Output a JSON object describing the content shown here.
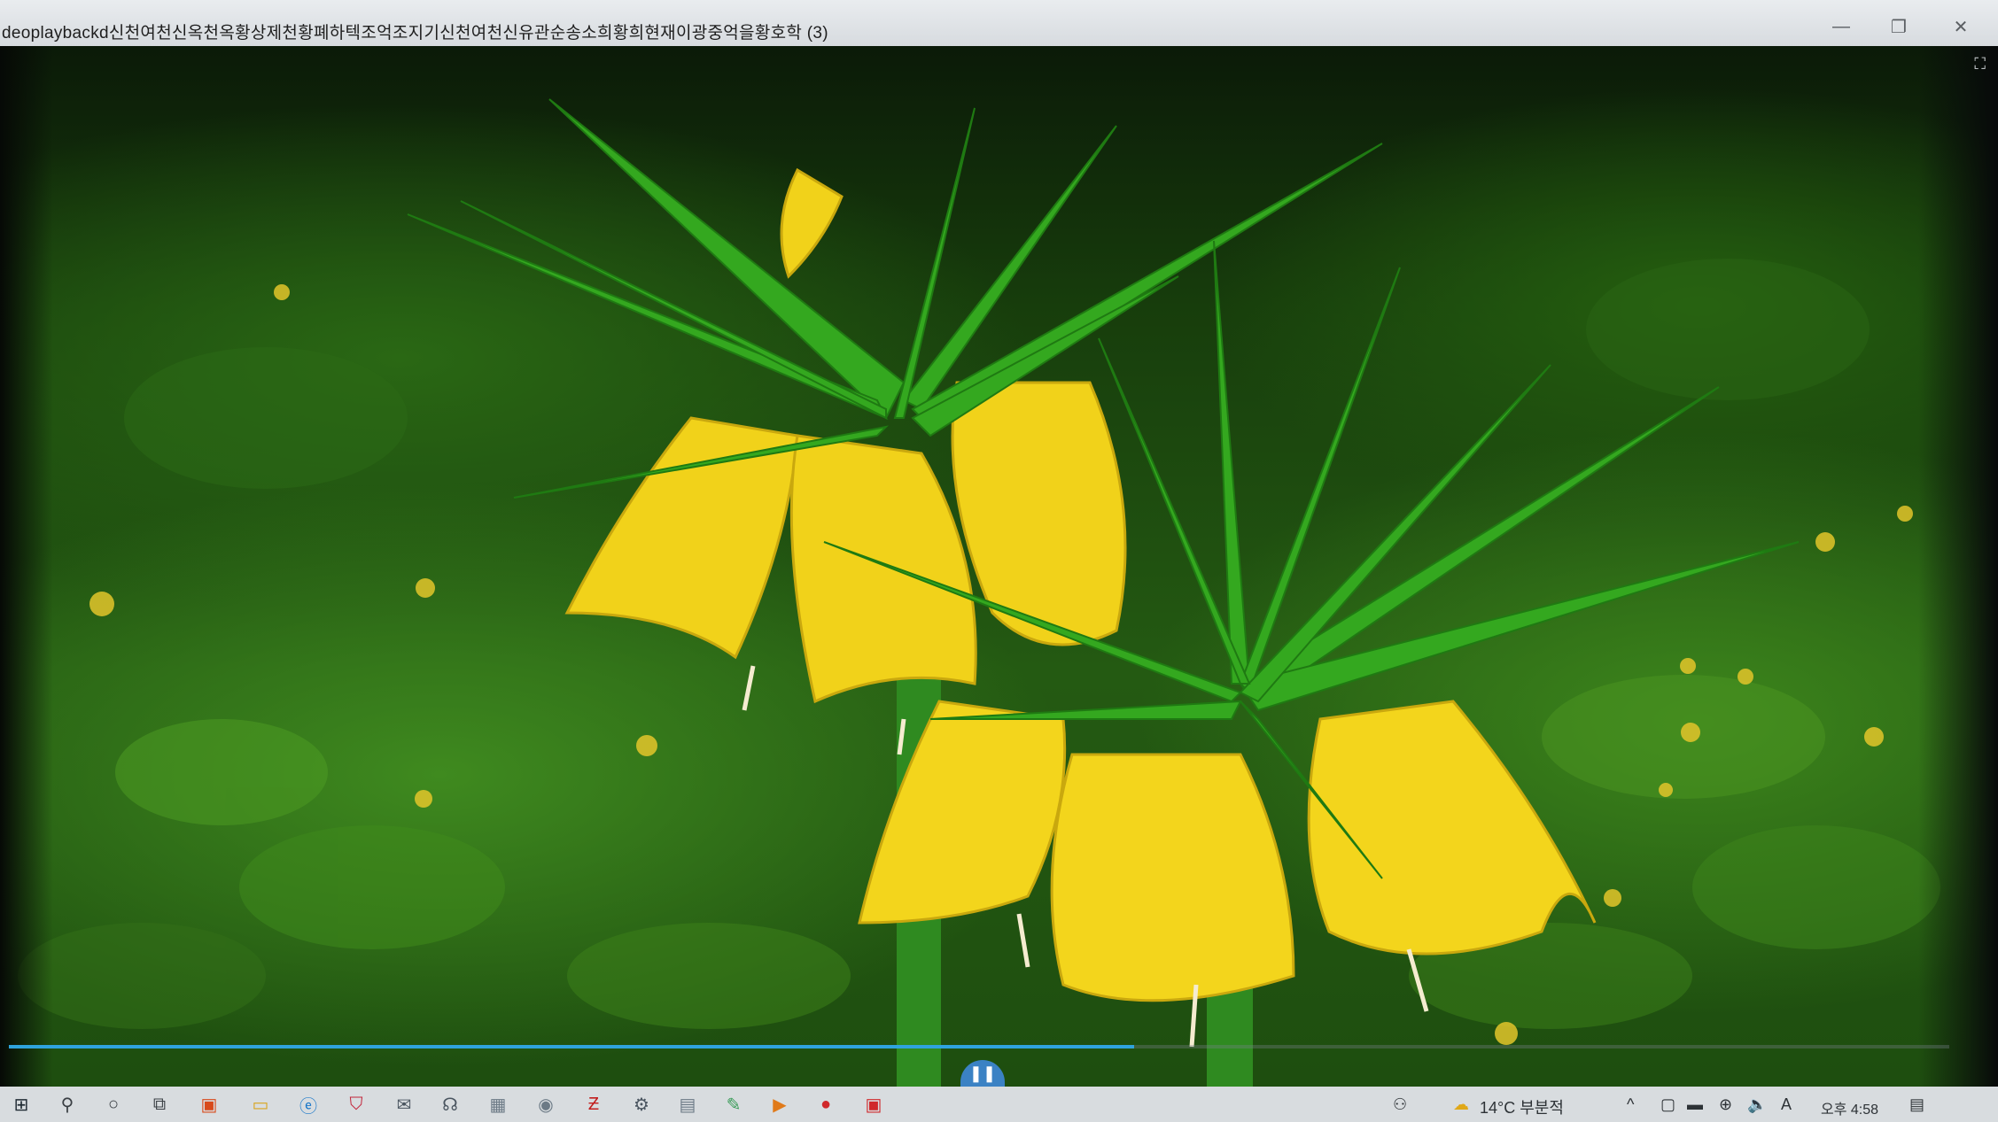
{
  "window": {
    "title": "deoplaybackd신천여천신옥천옥황상제천황폐하텍조억조지기신천여천신유관순송소희황희현재이광중억을황호학 (3)",
    "controls": {
      "minimize": "—",
      "maximize": "❐",
      "close": "✕"
    },
    "fullscreen_icon": "⛶"
  },
  "player": {
    "progress_fraction": 0.58,
    "play_pause_icon": "❚❚",
    "accent_color": "#2fa3dd"
  },
  "taskbar": {
    "icons": [
      {
        "name": "start-icon",
        "glyph": "⊞",
        "color": "#1f2a33"
      },
      {
        "name": "search-icon",
        "glyph": "⚲",
        "color": "#3a3f44"
      },
      {
        "name": "cortana-icon",
        "glyph": "○",
        "color": "#3a3f44"
      },
      {
        "name": "task-view-icon",
        "glyph": "⧉",
        "color": "#3a3f44"
      },
      {
        "name": "office-icon",
        "glyph": "▣",
        "color": "#d84a1b"
      },
      {
        "name": "file-explorer-icon",
        "glyph": "▭",
        "color": "#d9a520"
      },
      {
        "name": "edge-icon",
        "glyph": "ⓔ",
        "color": "#1877c9"
      },
      {
        "name": "shield-app-icon",
        "glyph": "⛉",
        "color": "#c2243a"
      },
      {
        "name": "mail-icon",
        "glyph": "✉",
        "color": "#4a5560"
      },
      {
        "name": "headset-icon",
        "glyph": "☊",
        "color": "#4a5560"
      },
      {
        "name": "photos-icon",
        "glyph": "▦",
        "color": "#6c7a86"
      },
      {
        "name": "camera-icon",
        "glyph": "◉",
        "color": "#6c7a86"
      },
      {
        "name": "filezilla-icon",
        "glyph": "Ƶ",
        "color": "#c21d1d"
      },
      {
        "name": "settings-icon",
        "glyph": "⚙",
        "color": "#4a5560"
      },
      {
        "name": "calculator-icon",
        "glyph": "▤",
        "color": "#6c7a86"
      },
      {
        "name": "notepad-icon",
        "glyph": "✎",
        "color": "#3c9c5a"
      },
      {
        "name": "media-icon",
        "glyph": "▶",
        "color": "#e07a1a"
      },
      {
        "name": "record-icon",
        "glyph": "●",
        "color": "#d0282b"
      },
      {
        "name": "store-icon",
        "glyph": "▣",
        "color": "#d0282b"
      }
    ],
    "tray": {
      "people_icon": "⚇",
      "weather_icon": "☁",
      "weather_text": "14°C 부분적",
      "chevron_icon": "^",
      "tray_icons": [
        "▢",
        "▬",
        "⊕",
        "🔈"
      ],
      "ime_text": "A",
      "clock_text": "오후 4:58",
      "notification_icon": "▤"
    }
  }
}
